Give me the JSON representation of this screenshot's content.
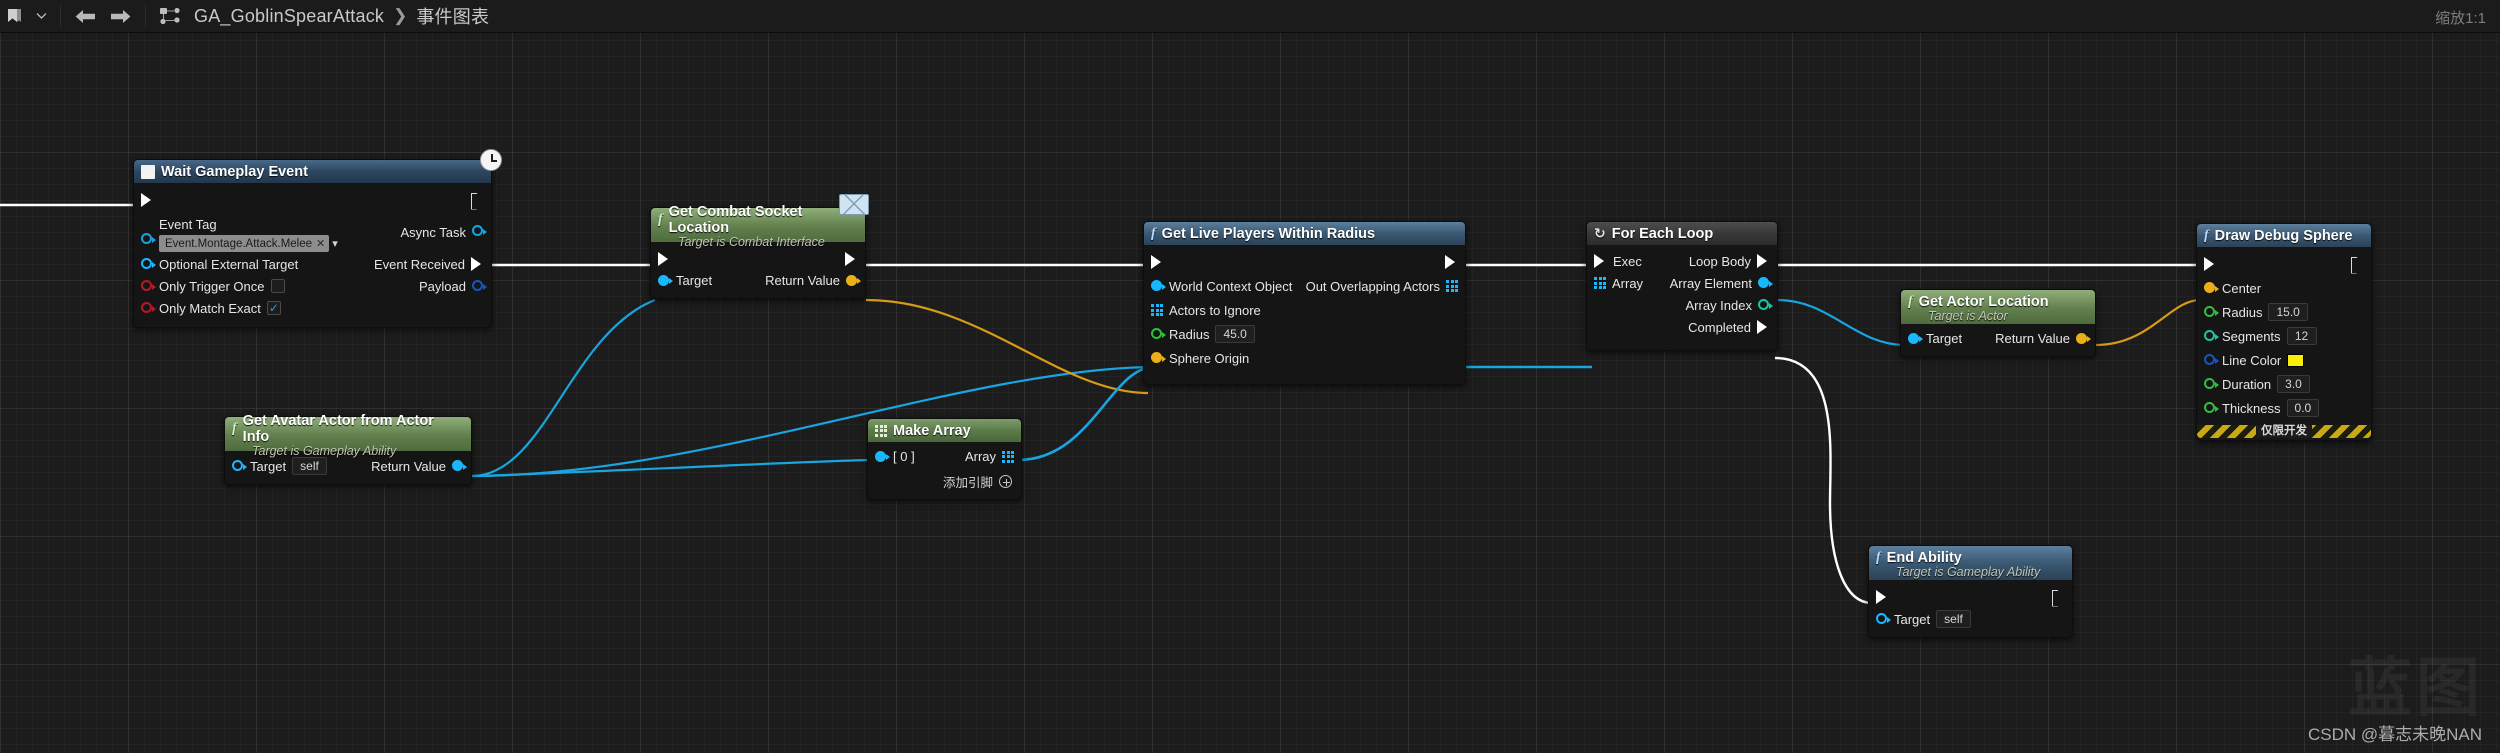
{
  "toolbar": {
    "bookmark_label": "bookmark-icon",
    "dropdown_label": "chevron-down-icon",
    "back_label": "back-arrow-icon",
    "forward_label": "forward-arrow-icon",
    "graph_icon_label": "graph-icon",
    "breadcrumb_asset": "GA_GoblinSpearAttack",
    "breadcrumb_sep": "❯",
    "breadcrumb_graph": "事件图表",
    "zoom_label": "缩放1:1"
  },
  "watermark": {
    "big": "蓝图",
    "small": "CSDN @暮志未晚NAN"
  },
  "nodes": {
    "wait_gameplay_event": {
      "title": "Wait Gameplay Event",
      "inputs": {
        "event_tag_label": "Event Tag",
        "event_tag_value": "Event.Montage.Attack.Melee",
        "event_tag_clear": "✕",
        "event_tag_chevron": "▾",
        "optional_external_target": "Optional External Target",
        "only_trigger_once": "Only Trigger Once",
        "only_trigger_once_checked": false,
        "only_match_exact": "Only Match Exact",
        "only_match_exact_checked": true
      },
      "outputs": {
        "async_task": "Async Task",
        "event_received": "Event Received",
        "payload": "Payload"
      }
    },
    "get_combat_socket_location": {
      "title": "Get Combat Socket Location",
      "subtitle": "Target is Combat Interface",
      "target": "Target",
      "return_value": "Return Value"
    },
    "get_avatar_actor": {
      "title": "Get Avatar Actor from Actor Info",
      "subtitle": "Target is Gameplay Ability",
      "target": "Target",
      "target_value": "self",
      "return_value": "Return Value"
    },
    "make_array": {
      "title": "Make Array",
      "element_0": "[ 0 ]",
      "array": "Array",
      "add_pin": "添加引脚"
    },
    "get_live_players": {
      "title": "Get Live Players Within Radius",
      "world_context_object": "World Context Object",
      "actors_to_ignore": "Actors to Ignore",
      "radius_label": "Radius",
      "radius_value": "45.0",
      "sphere_origin": "Sphere Origin",
      "out_overlapping_actors": "Out Overlapping Actors"
    },
    "for_each_loop": {
      "title": "For Each Loop",
      "exec": "Exec",
      "array": "Array",
      "loop_body": "Loop Body",
      "array_element": "Array Element",
      "array_index": "Array Index",
      "completed": "Completed"
    },
    "get_actor_location": {
      "title": "Get Actor Location",
      "subtitle": "Target is Actor",
      "target": "Target",
      "return_value": "Return Value"
    },
    "draw_debug_sphere": {
      "title": "Draw Debug Sphere",
      "center": "Center",
      "radius_label": "Radius",
      "radius_value": "15.0",
      "segments_label": "Segments",
      "segments_value": "12",
      "line_color_label": "Line Color",
      "line_color_value": "#f7ee0a",
      "duration_label": "Duration",
      "duration_value": "3.0",
      "thickness_label": "Thickness",
      "thickness_value": "0.0",
      "dev_only": "仅限开发"
    },
    "end_ability": {
      "title": "End Ability",
      "subtitle": "Target is Gameplay Ability",
      "target": "Target",
      "target_value": "self"
    }
  }
}
